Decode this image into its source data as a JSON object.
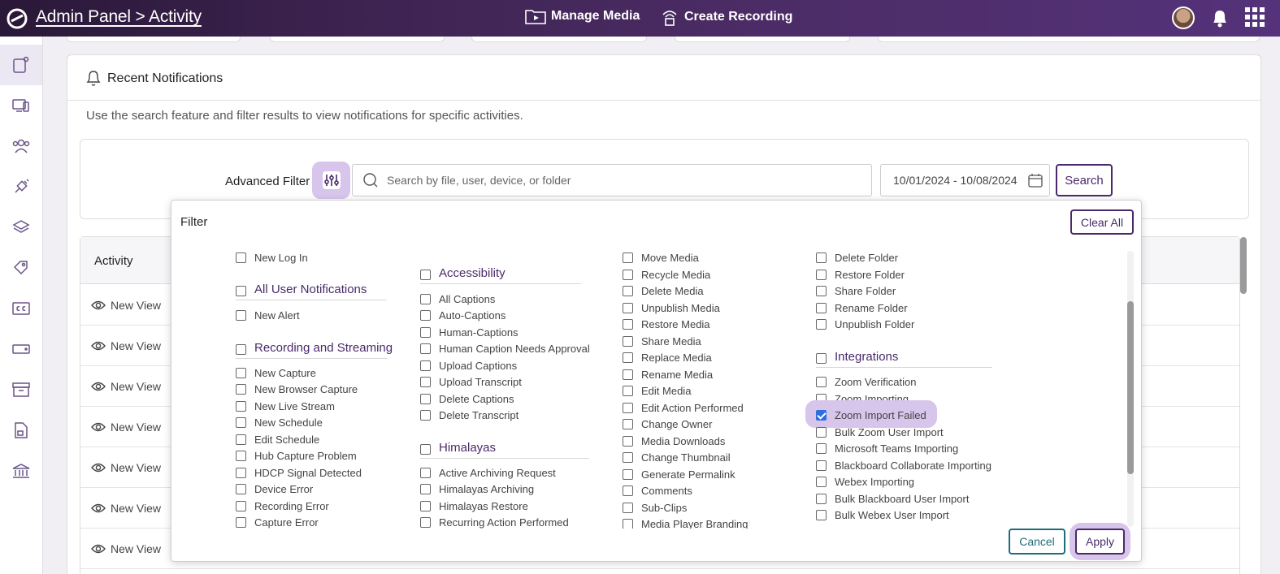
{
  "header": {
    "breadcrumb": "Admin Panel > Activity",
    "manage_media": "Manage Media",
    "create_recording": "Create Recording"
  },
  "sidebar": {
    "icons": [
      "activity-icon",
      "devices-icon",
      "users-icon",
      "integrations-icon",
      "layers-icon",
      "tags-icon",
      "captions-icon",
      "storage-icon",
      "archive-icon",
      "reports-icon",
      "institution-icon"
    ]
  },
  "panel": {
    "title": "Recent Notifications",
    "description": "Use the search feature and filter results to view notifications for specific activities.",
    "advanced_filter_label": "Advanced Filter",
    "search_placeholder": "Search by file, user, device, or folder",
    "date_range": "10/01/2024 - 10/08/2024",
    "search_button": "Search"
  },
  "table": {
    "column_activity": "Activity",
    "rows": [
      "New View",
      "New View",
      "New View",
      "New View",
      "New View",
      "New View",
      "New View"
    ]
  },
  "filter": {
    "title": "Filter",
    "clear_all": "Clear All",
    "cancel": "Cancel",
    "apply": "Apply",
    "col1": {
      "top": [
        "New Log In"
      ],
      "group1": {
        "label": "All User Notifications",
        "items": [
          "New Alert"
        ]
      },
      "group2": {
        "label": "Recording and Streaming",
        "items": [
          "New Capture",
          "New Browser Capture",
          "New Live Stream",
          "New Schedule",
          "Edit Schedule",
          "Hub Capture Problem",
          "HDCP Signal Detected",
          "Device Error",
          "Recording Error",
          "Capture Error"
        ]
      }
    },
    "col2": {
      "group1": {
        "label": "Accessibility",
        "items": [
          "All Captions",
          "Auto-Captions",
          "Human-Captions",
          "Human Caption Needs Approval",
          "Upload Captions",
          "Upload Transcript",
          "Delete Captions",
          "Delete Transcript"
        ]
      },
      "group2": {
        "label": "Himalayas",
        "items": [
          "Active Archiving Request",
          "Himalayas Archiving",
          "Himalayas Restore",
          "Recurring Action Performed"
        ]
      }
    },
    "col3": {
      "items": [
        "Move Media",
        "Recycle Media",
        "Delete Media",
        "Unpublish Media",
        "Restore Media",
        "Share Media",
        "Replace Media",
        "Rename Media",
        "Edit Media",
        "Edit Action Performed",
        "Change Owner",
        "Media Downloads",
        "Change Thumbnail",
        "Generate Permalink",
        "Comments",
        "Sub-Clips",
        "Media Player Branding"
      ]
    },
    "col4": {
      "top": [
        "Delete Folder",
        "Restore Folder",
        "Share Folder",
        "Rename Folder",
        "Unpublish Folder"
      ],
      "group1": {
        "label": "Integrations",
        "items": [
          "Zoom Verification",
          "Zoom Importing",
          "Zoom Import Failed",
          "Bulk Zoom User Import",
          "Microsoft Teams Importing",
          "Blackboard Collaborate Importing",
          "Webex Importing",
          "Bulk Blackboard User Import",
          "Bulk Webex User Import"
        ]
      }
    },
    "checked": [
      "Zoom Import Failed"
    ]
  }
}
